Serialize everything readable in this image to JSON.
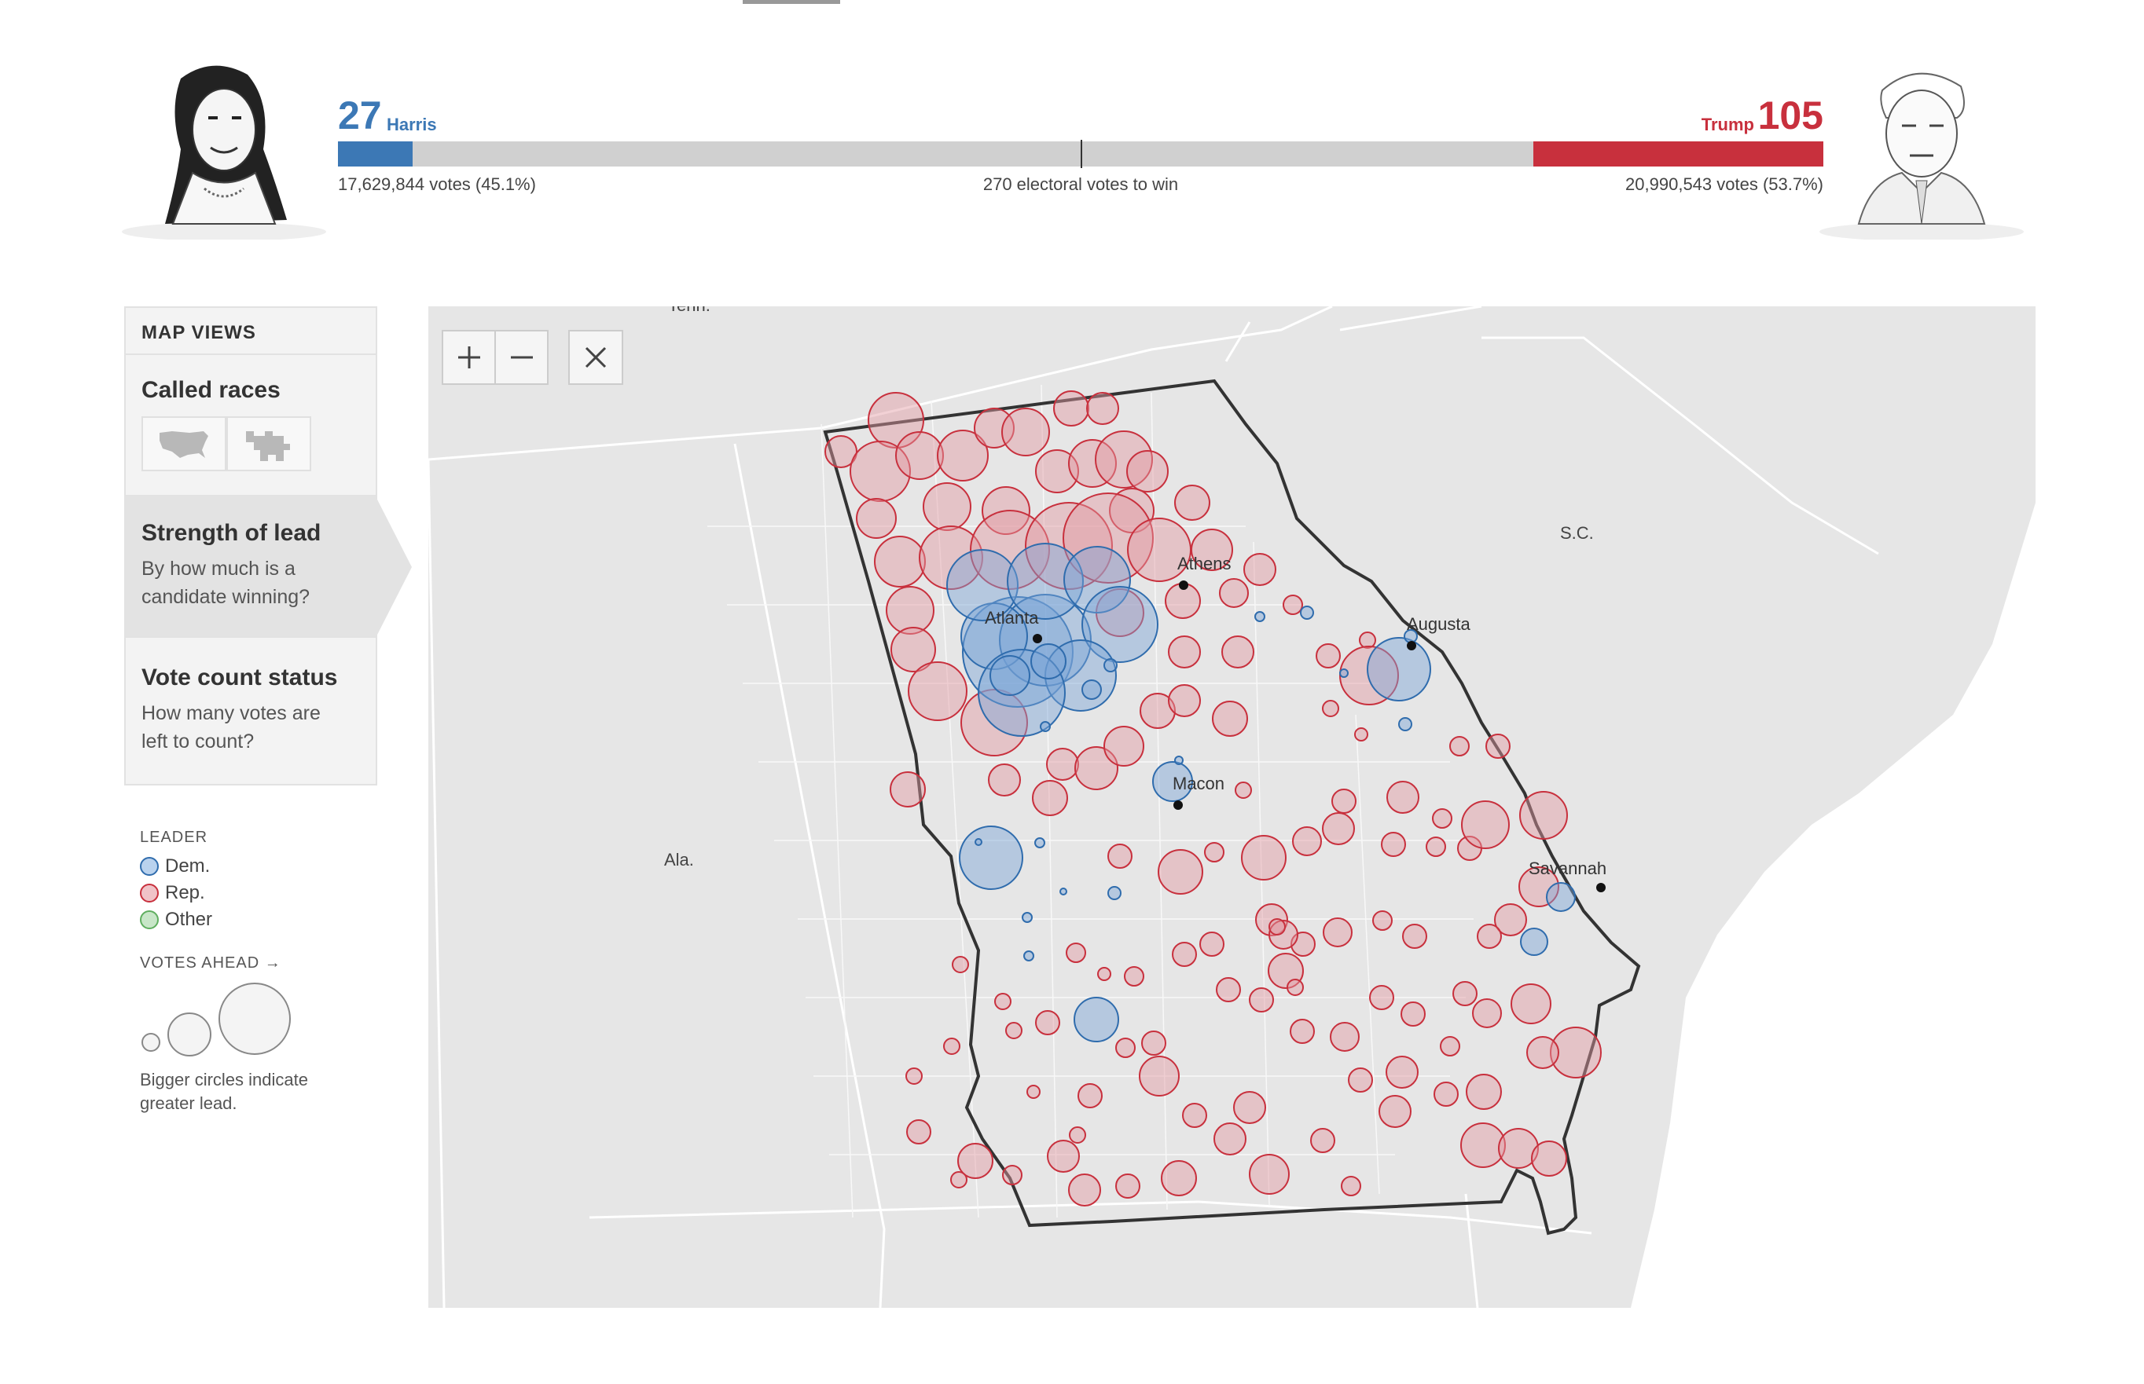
{
  "header": {
    "harris": {
      "name": "Harris",
      "electoral_votes": "27",
      "votes_text": "17,629,844 votes (45.1%)",
      "color": "#3c78b5",
      "ev_fraction": 0.0502
    },
    "trump": {
      "name": "Trump",
      "electoral_votes": "105",
      "votes_text": "20,990,543 votes (53.7%)",
      "color": "#c8303d",
      "ev_fraction": 0.1952
    },
    "to_win_text": "270 electoral votes to win"
  },
  "sidebar": {
    "heading": "MAP VIEWS",
    "views": [
      {
        "title": "Called races",
        "description": "",
        "icons": [
          "us-map-icon",
          "cartogram-icon"
        ]
      },
      {
        "title": "Strength of lead",
        "description": "By how much is a candidate winning?",
        "selected": true
      },
      {
        "title": "Vote count status",
        "description": "How many votes are left to count?"
      }
    ]
  },
  "legend": {
    "leader_heading": "LEADER",
    "items": [
      {
        "label": "Dem.",
        "color": "#4a86c5"
      },
      {
        "label": "Rep.",
        "color": "#c8303d"
      },
      {
        "label": "Other",
        "color": "#5fae5f"
      }
    ],
    "votes_ahead_heading": "VOTES AHEAD →",
    "note": "Bigger circles indicate greater lead."
  },
  "map": {
    "labels": {
      "tenn": "Tenn.",
      "sc": "S.C.",
      "ala": "Ala."
    },
    "cities": [
      "Athens",
      "Atlanta",
      "Augusta",
      "Macon",
      "Savannah"
    ],
    "zoom_in": "+",
    "zoom_out": "−",
    "colors": {
      "dem_fill": "#7ba5d6",
      "dem_stroke": "#2f6cad",
      "rep_fill": "#e39aa2",
      "rep_stroke": "#c8303d",
      "land": "#e6e6e6",
      "outside": "#ffffff"
    }
  }
}
